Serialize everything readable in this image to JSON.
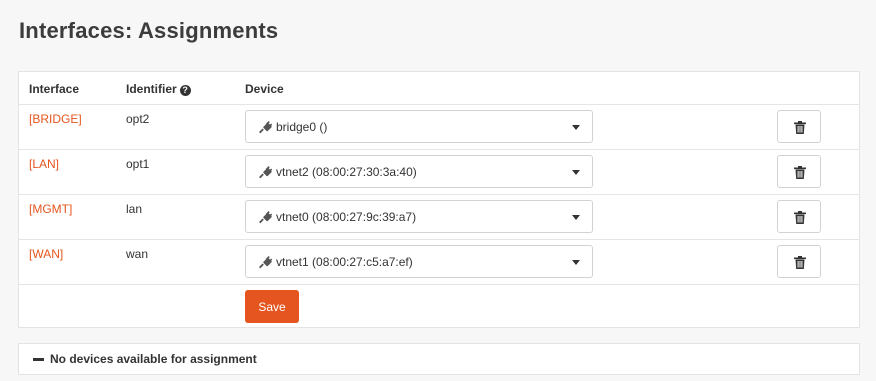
{
  "page": {
    "title": "Interfaces: Assignments"
  },
  "table": {
    "headers": {
      "interface": "Interface",
      "identifier": "Identifier",
      "device": "Device"
    },
    "rows": [
      {
        "interface": "[BRIDGE]",
        "identifier": "opt2",
        "device": "bridge0 ()"
      },
      {
        "interface": "[LAN]",
        "identifier": "opt1",
        "device": "vtnet2 (08:00:27:30:3a:40)"
      },
      {
        "interface": "[MGMT]",
        "identifier": "lan",
        "device": "vtnet0 (08:00:27:9c:39:a7)"
      },
      {
        "interface": "[WAN]",
        "identifier": "wan",
        "device": "vtnet1 (08:00:27:c5:a7:ef)"
      }
    ]
  },
  "actions": {
    "save_label": "Save"
  },
  "footer_panel": {
    "label": "No devices available for assignment"
  },
  "icons": {
    "help": "question-circle-icon",
    "device": "plug-icon",
    "delete": "trash-icon",
    "toggle": "minus-icon",
    "dropdown": "caret-down-icon"
  },
  "colors": {
    "accent": "#e4551f",
    "link": "#e4551f"
  }
}
